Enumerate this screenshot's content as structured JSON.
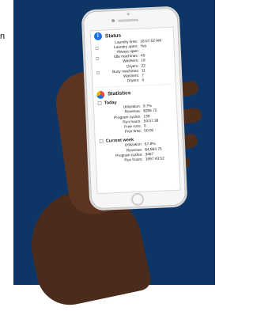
{
  "background": {
    "navy": "#0d3566",
    "stray_letter": "n"
  },
  "phone": {
    "status": {
      "title": "Status",
      "rows": [
        {
          "label": "Laundry time:",
          "value": "18:07:52 AM"
        },
        {
          "label": "Laundry open:",
          "value": "Yes"
        },
        {
          "label": "Always open",
          "value": ""
        },
        {
          "label": "Idle machines:",
          "value": "40"
        },
        {
          "label": "Washers:",
          "value": "18"
        },
        {
          "label": "Dryers:",
          "value": "22"
        },
        {
          "label": "Busy machines:",
          "value": "11"
        },
        {
          "label": "Washers:",
          "value": "7"
        },
        {
          "label": "Dryers:",
          "value": "4"
        }
      ]
    },
    "statistics": {
      "title": "Statistics",
      "today": {
        "title": "Today",
        "rows": [
          {
            "label": "Utilization:",
            "value": "9.7%"
          },
          {
            "label": "Revenue:",
            "value": "$286.75"
          },
          {
            "label": "Program cycles:",
            "value": "139"
          },
          {
            "label": "Run hours:",
            "value": "54:07:38"
          },
          {
            "label": "Free runs:",
            "value": "0"
          },
          {
            "label": "Free time:",
            "value": "00:00"
          }
        ]
      },
      "current_week": {
        "title": "Current week",
        "rows": [
          {
            "label": "Utilization:",
            "value": "67.8%"
          },
          {
            "label": "Revenue:",
            "value": "$4,984.75"
          },
          {
            "label": "Program cycles:",
            "value": "3487"
          },
          {
            "label": "Run hours:",
            "value": "1997:43:52"
          }
        ]
      }
    }
  }
}
